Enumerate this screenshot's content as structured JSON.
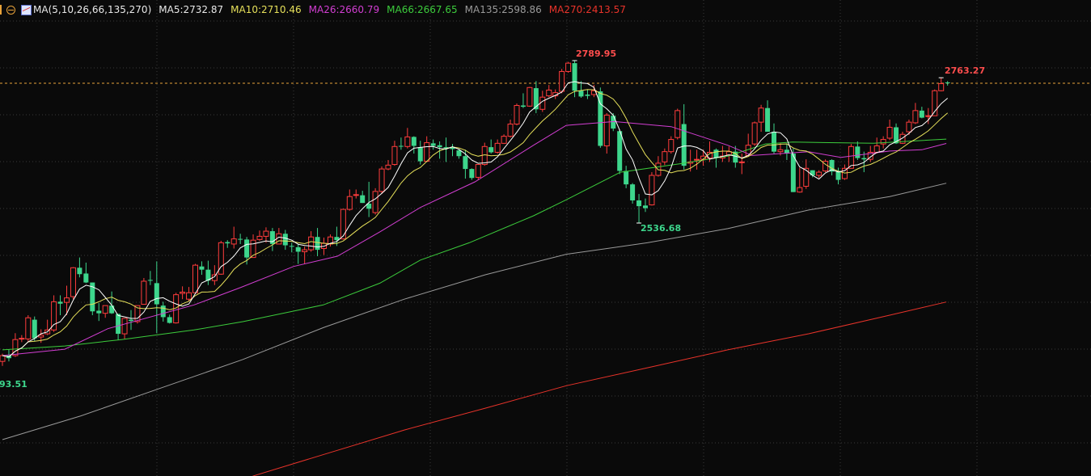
{
  "header": {
    "ma_params": "MA(5,10,26,66,135,270)",
    "ma5": "MA5:2732.87",
    "ma10": "MA10:2710.46",
    "ma26": "MA26:2660.79",
    "ma66": "MA66:2667.65",
    "ma135": "MA135:2598.86",
    "ma270": "MA270:2413.57"
  },
  "annotations": {
    "high": "2789.95",
    "low": "2536.68",
    "recent_high": "2763.27",
    "left_low": "93.51"
  },
  "colors": {
    "background": "#0a0a0a",
    "up": "#ff3c3c",
    "down": "#3dd68c",
    "ma5": "#ffffff",
    "ma10": "#e6e05a",
    "ma26": "#d23ed2",
    "ma66": "#3ccc3c",
    "ma135": "#9a9a9a",
    "ma270": "#e8332a",
    "price_line": "#e8a23a",
    "grid": "#3a3a3a"
  },
  "chart_data": {
    "type": "candlestick",
    "ylim": [
      2142.3,
      2884.45
    ],
    "current_price": 2754.7,
    "high": {
      "index": 89,
      "value": 2789.95
    },
    "low": {
      "index": 99,
      "value": 2536.68
    },
    "recent_high": {
      "index": 146,
      "value": 2763.27
    },
    "candles_ohlc": [
      [
        2321,
        2333,
        2314,
        2330
      ],
      [
        2330,
        2340,
        2321,
        2326
      ],
      [
        2330,
        2365,
        2328,
        2355
      ],
      [
        2356,
        2362,
        2351,
        2357
      ],
      [
        2356,
        2393,
        2352,
        2389
      ],
      [
        2386,
        2391,
        2352,
        2357
      ],
      [
        2359,
        2371,
        2350,
        2362
      ],
      [
        2364,
        2386,
        2362,
        2370
      ],
      [
        2370,
        2424,
        2367,
        2414
      ],
      [
        2414,
        2424,
        2393,
        2411
      ],
      [
        2413,
        2439,
        2393,
        2420
      ],
      [
        2422,
        2468,
        2418,
        2467
      ],
      [
        2467,
        2483,
        2452,
        2457
      ],
      [
        2458,
        2475,
        2443,
        2444
      ],
      [
        2444,
        2444,
        2393,
        2399
      ],
      [
        2400,
        2412,
        2384,
        2396
      ],
      [
        2396,
        2408,
        2389,
        2408
      ],
      [
        2408,
        2430,
        2395,
        2396
      ],
      [
        2395,
        2395,
        2354,
        2364
      ],
      [
        2364,
        2388,
        2356,
        2388
      ],
      [
        2386,
        2401,
        2370,
        2384
      ],
      [
        2383,
        2408,
        2380,
        2408
      ],
      [
        2410,
        2451,
        2410,
        2446
      ],
      [
        2448,
        2462,
        2440,
        2447
      ],
      [
        2443,
        2477,
        2365,
        2410
      ],
      [
        2408,
        2414,
        2383,
        2390
      ],
      [
        2390,
        2394,
        2380,
        2381
      ],
      [
        2381,
        2428,
        2380,
        2425
      ],
      [
        2427,
        2438,
        2418,
        2429
      ],
      [
        2418,
        2437,
        2415,
        2428
      ],
      [
        2428,
        2473,
        2427,
        2471
      ],
      [
        2469,
        2477,
        2456,
        2464
      ],
      [
        2464,
        2478,
        2440,
        2447
      ],
      [
        2447,
        2471,
        2440,
        2456
      ],
      [
        2457,
        2509,
        2456,
        2506
      ],
      [
        2507,
        2510,
        2498,
        2505
      ],
      [
        2504,
        2531,
        2497,
        2512
      ],
      [
        2512,
        2520,
        2504,
        2511
      ],
      [
        2511,
        2515,
        2472,
        2483
      ],
      [
        2483,
        2519,
        2483,
        2510
      ],
      [
        2511,
        2525,
        2509,
        2516
      ],
      [
        2516,
        2530,
        2506,
        2524
      ],
      [
        2524,
        2529,
        2493,
        2504
      ],
      [
        2504,
        2529,
        2504,
        2520
      ],
      [
        2520,
        2526,
        2495,
        2502
      ],
      [
        2501,
        2506,
        2491,
        2500
      ],
      [
        2499,
        2504,
        2473,
        2492
      ],
      [
        2492,
        2500,
        2473,
        2495
      ],
      [
        2495,
        2524,
        2492,
        2515
      ],
      [
        2515,
        2529,
        2485,
        2495
      ],
      [
        2497,
        2514,
        2487,
        2505
      ],
      [
        2504,
        2519,
        2500,
        2515
      ],
      [
        2515,
        2531,
        2501,
        2510
      ],
      [
        2512,
        2559,
        2511,
        2558
      ],
      [
        2558,
        2589,
        2556,
        2578
      ],
      [
        2580,
        2589,
        2575,
        2581
      ],
      [
        2580,
        2587,
        2568,
        2568
      ],
      [
        2567,
        2601,
        2546,
        2559
      ],
      [
        2553,
        2591,
        2550,
        2586
      ],
      [
        2586,
        2625,
        2582,
        2621
      ],
      [
        2621,
        2635,
        2619,
        2627
      ],
      [
        2628,
        2665,
        2626,
        2656
      ],
      [
        2657,
        2670,
        2651,
        2656
      ],
      [
        2656,
        2685,
        2653,
        2671
      ],
      [
        2671,
        2672,
        2645,
        2657
      ],
      [
        2655,
        2665,
        2628,
        2633
      ],
      [
        2633,
        2672,
        2632,
        2662
      ],
      [
        2661,
        2667,
        2651,
        2657
      ],
      [
        2658,
        2664,
        2637,
        2655
      ],
      [
        2655,
        2670,
        2632,
        2653
      ],
      [
        2655,
        2660,
        2641,
        2652
      ],
      [
        2650,
        2652,
        2637,
        2641
      ],
      [
        2641,
        2651,
        2606,
        2621
      ],
      [
        2621,
        2622,
        2604,
        2607
      ],
      [
        2608,
        2628,
        2604,
        2628
      ],
      [
        2628,
        2662,
        2626,
        2656
      ],
      [
        2655,
        2667,
        2645,
        2647
      ],
      [
        2647,
        2667,
        2645,
        2661
      ],
      [
        2661,
        2675,
        2660,
        2672
      ],
      [
        2672,
        2698,
        2670,
        2691
      ],
      [
        2691,
        2723,
        2689,
        2720
      ],
      [
        2720,
        2739,
        2716,
        2718
      ],
      [
        2719,
        2749,
        2718,
        2748
      ],
      [
        2747,
        2758,
        2708,
        2714
      ],
      [
        2714,
        2743,
        2710,
        2733
      ],
      [
        2735,
        2752,
        2733,
        2744
      ],
      [
        2735,
        2745,
        2730,
        2740
      ],
      [
        2742,
        2777,
        2739,
        2773
      ],
      [
        2773,
        2788,
        2771,
        2786
      ],
      [
        2786,
        2789.95,
        2733,
        2743
      ],
      [
        2743,
        2758,
        2732,
        2734
      ],
      [
        2737,
        2745,
        2730,
        2735
      ],
      [
        2737,
        2752,
        2733,
        2743
      ],
      [
        2742,
        2748,
        2654,
        2657
      ],
      [
        2657,
        2708,
        2645,
        2705
      ],
      [
        2704,
        2708,
        2680,
        2684
      ],
      [
        2680,
        2683,
        2613,
        2618
      ],
      [
        2618,
        2626,
        2591,
        2597
      ],
      [
        2597,
        2599,
        2567,
        2572
      ],
      [
        2572,
        2582,
        2536.68,
        2563
      ],
      [
        2564,
        2575,
        2554,
        2560
      ],
      [
        2565,
        2616,
        2564,
        2611
      ],
      [
        2611,
        2641,
        2609,
        2630
      ],
      [
        2632,
        2653,
        2627,
        2648
      ],
      [
        2648,
        2672,
        2645,
        2667
      ],
      [
        2670,
        2715,
        2667,
        2712
      ],
      [
        2691,
        2722,
        2620,
        2626
      ],
      [
        2630,
        2651,
        2617,
        2632
      ],
      [
        2635,
        2651,
        2620,
        2636
      ],
      [
        2636,
        2651,
        2626,
        2641
      ],
      [
        2638,
        2664,
        2632,
        2647
      ],
      [
        2651,
        2653,
        2623,
        2638
      ],
      [
        2638,
        2657,
        2632,
        2641
      ],
      [
        2643,
        2656,
        2632,
        2648
      ],
      [
        2648,
        2657,
        2623,
        2631
      ],
      [
        2631,
        2645,
        2613,
        2632
      ],
      [
        2642,
        2676,
        2641,
        2658
      ],
      [
        2660,
        2695,
        2657,
        2693
      ],
      [
        2694,
        2721,
        2679,
        2716
      ],
      [
        2716,
        2728,
        2679,
        2679
      ],
      [
        2679,
        2692,
        2645,
        2648
      ],
      [
        2648,
        2661,
        2642,
        2651
      ],
      [
        2651,
        2661,
        2635,
        2645
      ],
      [
        2645,
        2653,
        2585,
        2585
      ],
      [
        2585,
        2623,
        2584,
        2592
      ],
      [
        2594,
        2636,
        2590,
        2622
      ],
      [
        2619,
        2619,
        2608,
        2611
      ],
      [
        2611,
        2619,
        2607,
        2616
      ],
      [
        2618,
        2636,
        2616,
        2633
      ],
      [
        2635,
        2636,
        2611,
        2617
      ],
      [
        2618,
        2623,
        2597,
        2604
      ],
      [
        2606,
        2628,
        2604,
        2622
      ],
      [
        2622,
        2660,
        2622,
        2656
      ],
      [
        2656,
        2664,
        2635,
        2638
      ],
      [
        2638,
        2648,
        2616,
        2636
      ],
      [
        2636,
        2657,
        2632,
        2647
      ],
      [
        2647,
        2670,
        2645,
        2657
      ],
      [
        2660,
        2672,
        2653,
        2667
      ],
      [
        2669,
        2698,
        2666,
        2686
      ],
      [
        2686,
        2692,
        2660,
        2661
      ],
      [
        2661,
        2679,
        2660,
        2675
      ],
      [
        2679,
        2698,
        2674,
        2694
      ],
      [
        2693,
        2724,
        2691,
        2712
      ],
      [
        2712,
        2718,
        2700,
        2701
      ],
      [
        2703,
        2716,
        2691,
        2704
      ],
      [
        2704,
        2745,
        2704,
        2743
      ],
      [
        2743,
        2763.27,
        2742,
        2754
      ],
      [
        2756,
        2758,
        2751,
        2754.7
      ]
    ],
    "ma_series": {
      "ma26": [
        [
          0,
          2330
        ],
        [
          9.7,
          2340
        ],
        [
          16.4,
          2372
        ],
        [
          29.8,
          2409
        ],
        [
          37,
          2436
        ],
        [
          45.3,
          2469
        ],
        [
          52.1,
          2485
        ],
        [
          58.7,
          2523
        ],
        [
          65,
          2561
        ],
        [
          73.5,
          2601
        ],
        [
          82.6,
          2658
        ],
        [
          87.7,
          2689
        ],
        [
          95.2,
          2695
        ],
        [
          104,
          2687
        ],
        [
          112.8,
          2658
        ],
        [
          116.6,
          2642
        ],
        [
          125.4,
          2648
        ],
        [
          130.4,
          2639
        ],
        [
          138,
          2649
        ],
        [
          143,
          2651
        ],
        [
          146.8,
          2660.79
        ]
      ],
      "ma66": [
        [
          0,
          2339
        ],
        [
          9.7,
          2345
        ],
        [
          18.5,
          2355
        ],
        [
          29.8,
          2370
        ],
        [
          37.4,
          2383
        ],
        [
          49.9,
          2409
        ],
        [
          58.7,
          2443
        ],
        [
          65,
          2479
        ],
        [
          72.6,
          2506
        ],
        [
          82.6,
          2548
        ],
        [
          87.7,
          2573
        ],
        [
          96.1,
          2616
        ],
        [
          105.3,
          2629
        ],
        [
          112.8,
          2641
        ],
        [
          118.7,
          2660
        ],
        [
          122.9,
          2663
        ],
        [
          135.5,
          2661
        ],
        [
          146.8,
          2667.65
        ]
      ],
      "ma135": [
        [
          0,
          2199
        ],
        [
          12.2,
          2236
        ],
        [
          24.8,
          2280
        ],
        [
          37.4,
          2324
        ],
        [
          50,
          2374
        ],
        [
          62.5,
          2418
        ],
        [
          75.1,
          2456
        ],
        [
          87.7,
          2488
        ],
        [
          100.3,
          2506
        ],
        [
          112.8,
          2528
        ],
        [
          125.4,
          2557
        ],
        [
          138,
          2578
        ],
        [
          146.8,
          2598.86
        ]
      ],
      "ma270": [
        [
          38.9,
          2142
        ],
        [
          50,
          2176
        ],
        [
          62.5,
          2214
        ],
        [
          75.1,
          2248
        ],
        [
          87.7,
          2283
        ],
        [
          100.3,
          2311
        ],
        [
          112.8,
          2339
        ],
        [
          125.4,
          2364
        ],
        [
          138,
          2393
        ],
        [
          146.8,
          2413.57
        ]
      ]
    }
  }
}
